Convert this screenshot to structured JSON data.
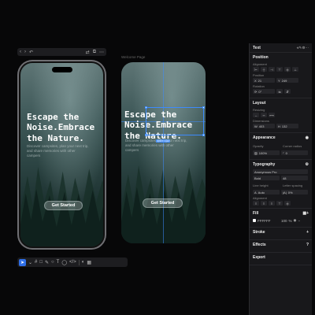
{
  "toolbar": {
    "back_glyph": "‹",
    "forward_glyph": "›",
    "undo_glyph": "↶",
    "icon1": "⇄",
    "icon2": "⧉",
    "icon3": "⋯"
  },
  "mockup": {
    "headline": "Escape the Noise.Embrace the Nature.",
    "subtext": "Discover campsites, plan your next trip, and share memories with other campers",
    "cta": "Get Started"
  },
  "frame": {
    "label": "Welcome Page",
    "headline": "Escape the Noise.Embrace the Nature.",
    "subtext": "Discover campsites, plan your next trip, and share memories with other campers",
    "cta": "Get Started",
    "selection_size": "403 × 132"
  },
  "bottom_toolbar": {
    "icons": [
      "move-tool",
      "frame-tool",
      "shape-tool",
      "pen-tool",
      "ellipse-tool",
      "text-tool",
      "comment-tool",
      "code-tool",
      "dev-mode"
    ]
  },
  "panel": {
    "title": "Text",
    "position": {
      "title": "Position",
      "alignment_label": "Alignment",
      "position_label": "Position",
      "x": "21",
      "y": "249",
      "rotation_label": "Rotation",
      "rotation": "0°"
    },
    "layout": {
      "title": "Layout",
      "resizing_label": "Resizing",
      "dimensions_label": "Dimensions",
      "w": "403",
      "h": "132"
    },
    "appearance": {
      "title": "Appearance",
      "opacity_label": "Opacity",
      "opacity": "100%",
      "corner_label": "Corner radius",
      "corner": "0"
    },
    "typography": {
      "title": "Typography",
      "font": "Anonymous Pro",
      "weight": "Bold",
      "size": "48",
      "line_height_label": "Line height",
      "line_height": "Auto",
      "letter_spacing_label": "Letter spacing",
      "letter_spacing": "0%",
      "alignment_label": "Alignment"
    },
    "fill": {
      "title": "Fill",
      "color": "FFFFFF",
      "opacity": "100",
      "unit": "%"
    },
    "stroke": {
      "title": "Stroke"
    },
    "effects": {
      "title": "Effects"
    },
    "export": {
      "title": "Export"
    }
  }
}
